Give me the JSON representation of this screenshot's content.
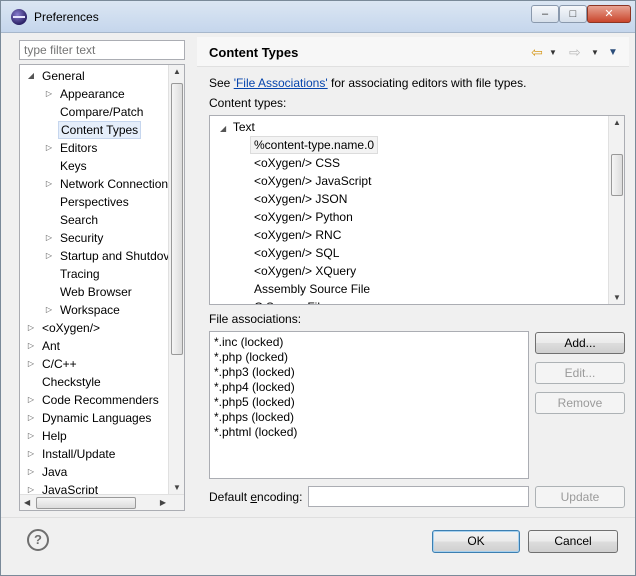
{
  "window": {
    "title": "Preferences"
  },
  "filter": {
    "placeholder": "type filter text"
  },
  "tree": {
    "items": [
      {
        "label": "General",
        "twisty": "expanded"
      },
      {
        "label": "Appearance",
        "twisty": "collapsed"
      },
      {
        "label": "Compare/Patch",
        "twisty": "none"
      },
      {
        "label": "Content Types",
        "twisty": "none",
        "selected": true
      },
      {
        "label": "Editors",
        "twisty": "collapsed"
      },
      {
        "label": "Keys",
        "twisty": "none"
      },
      {
        "label": "Network Connection",
        "twisty": "collapsed"
      },
      {
        "label": "Perspectives",
        "twisty": "none"
      },
      {
        "label": "Search",
        "twisty": "none"
      },
      {
        "label": "Security",
        "twisty": "collapsed"
      },
      {
        "label": "Startup and Shutdov",
        "twisty": "collapsed"
      },
      {
        "label": "Tracing",
        "twisty": "none"
      },
      {
        "label": "Web Browser",
        "twisty": "none"
      },
      {
        "label": "Workspace",
        "twisty": "collapsed"
      },
      {
        "label": "<oXygen/>",
        "twisty": "collapsed"
      },
      {
        "label": "Ant",
        "twisty": "collapsed"
      },
      {
        "label": "C/C++",
        "twisty": "collapsed"
      },
      {
        "label": "Checkstyle",
        "twisty": "none"
      },
      {
        "label": "Code Recommenders",
        "twisty": "collapsed"
      },
      {
        "label": "Dynamic Languages",
        "twisty": "collapsed"
      },
      {
        "label": "Help",
        "twisty": "collapsed"
      },
      {
        "label": "Install/Update",
        "twisty": "collapsed"
      },
      {
        "label": "Java",
        "twisty": "collapsed"
      },
      {
        "label": "JavaScript",
        "twisty": "collapsed"
      }
    ]
  },
  "page": {
    "title": "Content Types",
    "see_prefix": "See ",
    "see_link": "'File Associations'",
    "see_suffix": " for associating editors with file types.",
    "content_types_label": "Content types:",
    "file_assoc_label": "File associations:",
    "default_encoding_label_prefix": "Default ",
    "default_encoding_label_mnemonic": "e",
    "default_encoding_label_suffix": "ncoding:"
  },
  "content_types": {
    "root": "Text",
    "items": [
      "%content-type.name.0",
      "<oXygen/> CSS",
      "<oXygen/> JavaScript",
      "<oXygen/> JSON",
      "<oXygen/> Python",
      "<oXygen/> RNC",
      "<oXygen/> SQL",
      "<oXygen/> XQuery",
      "Assembly Source File",
      "C Source File"
    ]
  },
  "file_associations": [
    "*.inc (locked)",
    "*.php (locked)",
    "*.php3 (locked)",
    "*.php4 (locked)",
    "*.php5 (locked)",
    "*.phps (locked)",
    "*.phtml (locked)"
  ],
  "buttons": {
    "add": "Add...",
    "edit": "Edit...",
    "remove": "Remove",
    "update": "Update",
    "ok": "OK",
    "cancel": "Cancel"
  },
  "icons": {
    "back": "back-arrow-icon",
    "forward": "forward-arrow-icon",
    "menu": "view-menu-icon",
    "help": "help-icon"
  }
}
